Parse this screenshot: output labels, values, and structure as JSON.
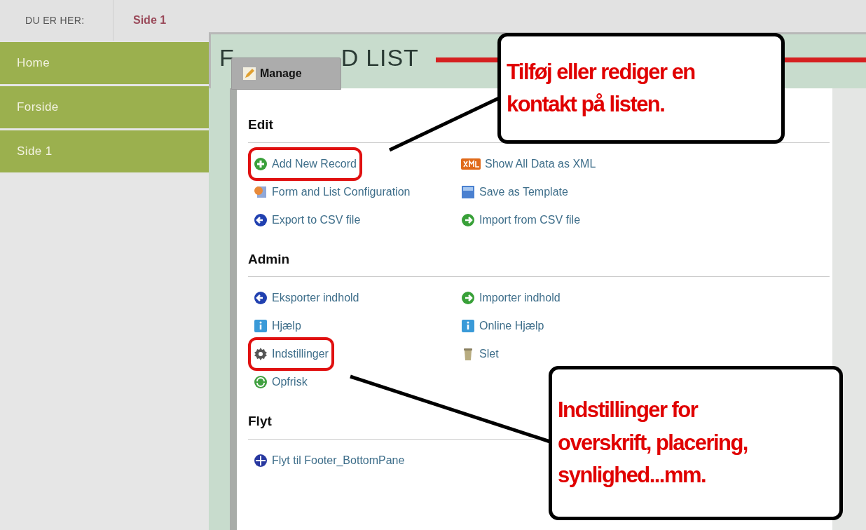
{
  "breadcrumb": {
    "label": "DU ER HER:",
    "current": "Side 1"
  },
  "sidebar": {
    "items": [
      {
        "label": "Home"
      },
      {
        "label": "Forside"
      },
      {
        "label": "Side 1"
      }
    ]
  },
  "module": {
    "title_parts": [
      "F",
      "D LIST"
    ],
    "manage_tab": "Manage",
    "sections": [
      {
        "title": "Edit",
        "items": [
          {
            "label": "Add New Record",
            "kind": "add",
            "highlighted": true
          },
          {
            "label": "Show All Data as XML",
            "kind": "xml",
            "highlighted": false
          },
          {
            "label": "Form and List Configuration",
            "kind": "config",
            "highlighted": false
          },
          {
            "label": "Save as Template",
            "kind": "template",
            "highlighted": false
          },
          {
            "label": "Export to CSV file",
            "kind": "export",
            "highlighted": false
          },
          {
            "label": "Import from CSV file",
            "kind": "import",
            "highlighted": false
          }
        ]
      },
      {
        "title": "Admin",
        "items": [
          {
            "label": "Eksporter indhold",
            "kind": "export",
            "highlighted": false
          },
          {
            "label": "Importer indhold",
            "kind": "import",
            "highlighted": false
          },
          {
            "label": "Hjælp",
            "kind": "help",
            "highlighted": false
          },
          {
            "label": "Online Hjælp",
            "kind": "help",
            "highlighted": false
          },
          {
            "label": "Indstillinger",
            "kind": "settings",
            "highlighted": true
          },
          {
            "label": "Slet",
            "kind": "delete",
            "highlighted": false
          },
          {
            "label": "Opfrisk",
            "kind": "refresh",
            "highlighted": false
          }
        ]
      },
      {
        "title": "Flyt",
        "items": [
          {
            "label": "Flyt til Footer_BottomPane",
            "kind": "move",
            "highlighted": false
          }
        ]
      }
    ]
  },
  "annotations": [
    {
      "lines": [
        "Tilføj eller rediger en",
        "kontakt på listen."
      ]
    },
    {
      "lines": [
        "Indstillinger for",
        "overskrift, placering,",
        "synlighed...mm."
      ]
    }
  ]
}
